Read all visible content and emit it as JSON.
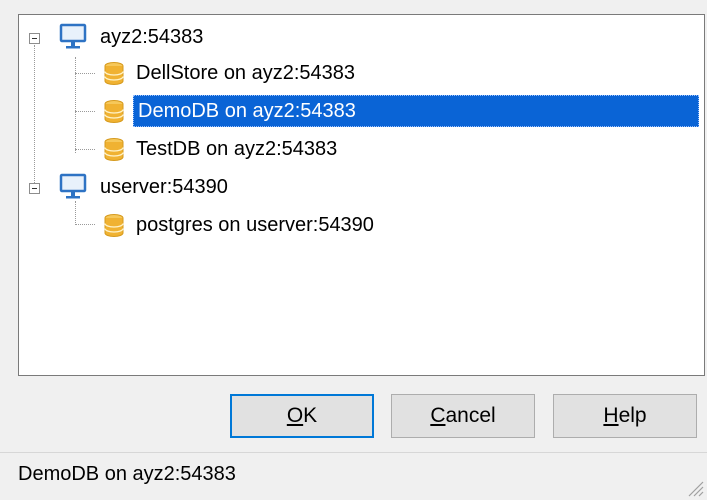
{
  "tree": {
    "servers": [
      {
        "label": "ayz2:54383",
        "icon": "computer-icon",
        "databases": [
          {
            "label": "DellStore on ayz2:54383",
            "icon": "database-icon"
          },
          {
            "label": "DemoDB on ayz2:54383",
            "icon": "database-icon",
            "selected": true
          },
          {
            "label": "TestDB on ayz2:54383",
            "icon": "database-icon"
          }
        ]
      },
      {
        "label": "userver:54390",
        "icon": "computer-icon",
        "databases": [
          {
            "label": "postgres on userver:54390",
            "icon": "database-icon"
          }
        ]
      }
    ]
  },
  "buttons": {
    "ok": {
      "mnemonic": "O",
      "rest": "K"
    },
    "cancel": {
      "mnemonic": "C",
      "rest": "ancel"
    },
    "help": {
      "mnemonic": "H",
      "rest": "elp"
    }
  },
  "status": {
    "text": "DemoDB on ayz2:54383"
  },
  "colors": {
    "selection": "#0a64d6",
    "default_button_border": "#0078d7",
    "db_icon": "#f0b232",
    "monitor": "#2e73c4"
  }
}
